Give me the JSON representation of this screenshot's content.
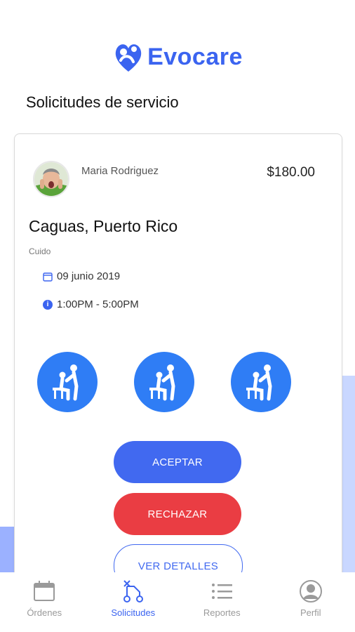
{
  "app": {
    "brand": "Evocare"
  },
  "header": {
    "title": "Solicitudes de servicio"
  },
  "request": {
    "client_name": "Maria Rodriguez",
    "price": "$180.00",
    "location": "Caguas, Puerto Rico",
    "service_type": "Cuido",
    "date": "09 junio 2019",
    "time": "1:00PM - 5:00PM",
    "care_icons": [
      "caregiver-assist-icon",
      "caregiver-assist-icon",
      "caregiver-assist-icon"
    ]
  },
  "actions": {
    "accept_label": "ACEPTAR",
    "reject_label": "RECHAZAR",
    "details_label": "VER DETALLES"
  },
  "nav": {
    "items": [
      {
        "label": "Órdenes",
        "icon": "calendar-icon",
        "active": false
      },
      {
        "label": "Solicitudes",
        "icon": "scissors-git-icon",
        "active": true
      },
      {
        "label": "Reportes",
        "icon": "list-icon",
        "active": false
      },
      {
        "label": "Perfil",
        "icon": "user-circle-icon",
        "active": false
      }
    ]
  },
  "colors": {
    "brand": "#3b64f0",
    "accept": "#4169f0",
    "reject": "#ea3d43",
    "care_icon_bg": "#2f7df5"
  }
}
